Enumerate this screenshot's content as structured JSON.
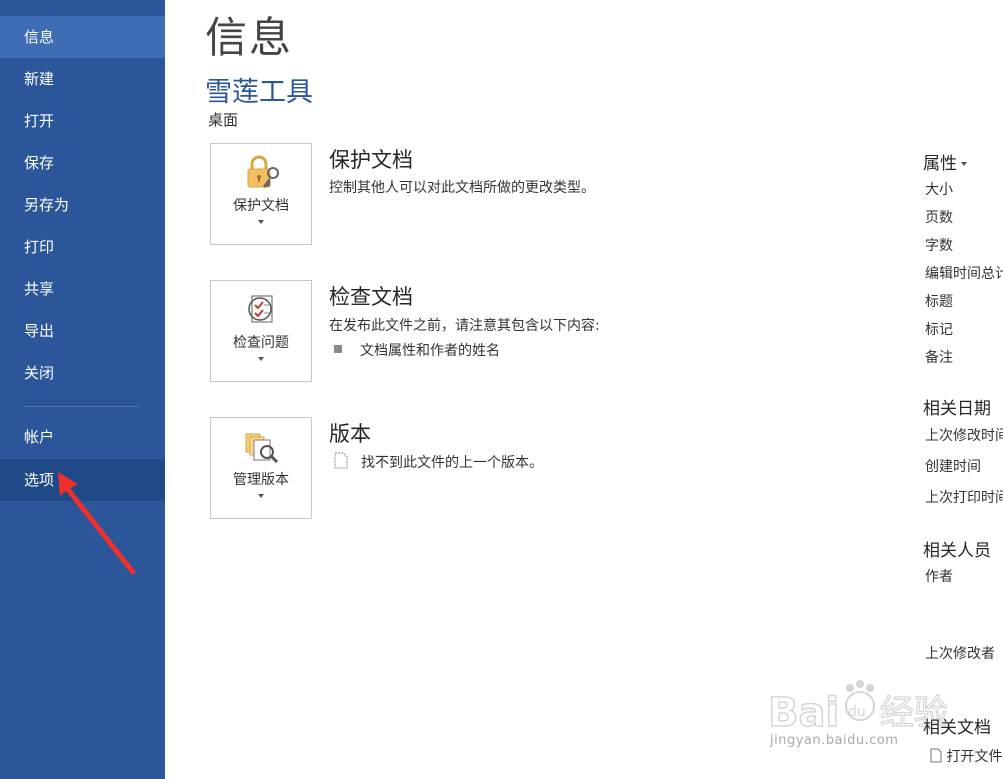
{
  "sidebar": {
    "items": [
      {
        "label": "信息"
      },
      {
        "label": "新建"
      },
      {
        "label": "打开"
      },
      {
        "label": "保存"
      },
      {
        "label": "另存为"
      },
      {
        "label": "打印"
      },
      {
        "label": "共享"
      },
      {
        "label": "导出"
      },
      {
        "label": "关闭"
      },
      {
        "label": "帐户"
      },
      {
        "label": "选项"
      }
    ],
    "active": "信息",
    "accent": "#2b579a"
  },
  "main": {
    "title": "信息",
    "doc_name": "雪莲工具",
    "doc_location": "桌面",
    "protect": {
      "tile_label": "保护文档",
      "title": "保护文档",
      "desc": "控制其他人可以对此文档所做的更改类型。",
      "icon": "lock-icon"
    },
    "inspect": {
      "tile_label": "检查问题",
      "title": "检查文档",
      "desc": "在发布此文件之前，请注意其包含以下内容:",
      "bullet": "文档属性和作者的姓名",
      "icon": "inspect-document-icon"
    },
    "versions": {
      "tile_label": "管理版本",
      "title": "版本",
      "desc": "找不到此文件的上一个版本。",
      "icon": "manage-versions-icon"
    }
  },
  "properties": {
    "header": "属性",
    "rows": [
      "大小",
      "页数",
      "字数",
      "编辑时间总计",
      "标题",
      "标记",
      "备注"
    ],
    "related_dates_header": "相关日期",
    "related_dates": [
      "上次修改时间",
      "创建时间",
      "上次打印时间"
    ],
    "related_people_header": "相关人员",
    "author_label": "作者",
    "last_modified_by_label": "上次修改者",
    "related_docs_header": "相关文档",
    "open_file_location": "打开文件位置"
  },
  "watermark": {
    "text": "jingyan.baidu.com"
  }
}
